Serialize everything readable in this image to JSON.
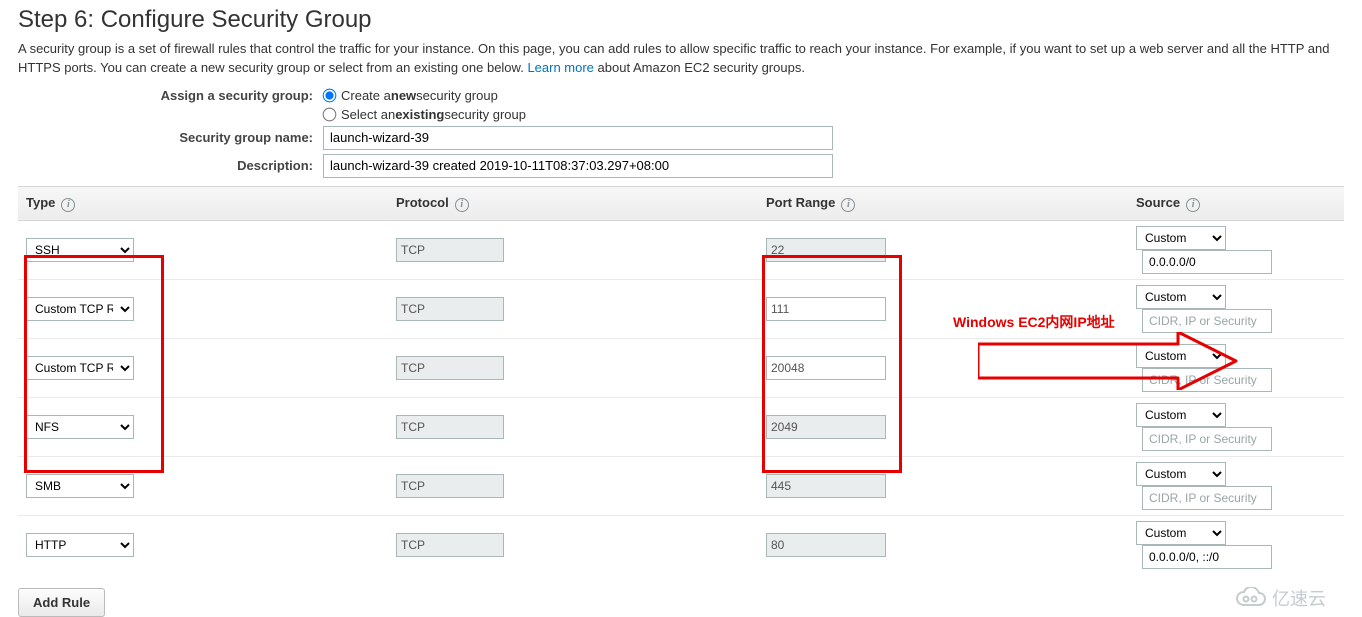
{
  "header": {
    "title": "Step 6: Configure Security Group",
    "description_pre": "A security group is a set of firewall rules that control the traffic for your instance. On this page, you can add rules to allow specific traffic to reach your instance. For example, if you want to set up a web server and all the HTTP and HTTPS ports. You can create a new security group or select from an existing one below. ",
    "learn_more_label": "Learn more",
    "description_post": " about Amazon EC2 security groups."
  },
  "form": {
    "assign_label": "Assign a security group:",
    "create_option_pre": "Create a ",
    "create_option_bold": "new",
    "create_option_post": " security group",
    "select_option_pre": "Select an ",
    "select_option_bold": "existing",
    "select_option_post": " security group",
    "name_label": "Security group name:",
    "name_value": "launch-wizard-39",
    "description_label": "Description:",
    "description_value": "launch-wizard-39 created 2019-10-11T08:37:03.297+08:00"
  },
  "columns": {
    "type": "Type",
    "protocol": "Protocol",
    "port_range": "Port Range",
    "source": "Source"
  },
  "cidr_placeholder": "CIDR, IP or Security",
  "rules": [
    {
      "type": "SSH",
      "protocol": "TCP",
      "port": "22",
      "port_editable": false,
      "source_type": "Custom",
      "cidr": "0.0.0.0/0"
    },
    {
      "type": "Custom TCP Rule",
      "protocol": "TCP",
      "port": "111",
      "port_editable": true,
      "source_type": "Custom",
      "cidr": ""
    },
    {
      "type": "Custom TCP Rule",
      "protocol": "TCP",
      "port": "20048",
      "port_editable": true,
      "source_type": "Custom",
      "cidr": ""
    },
    {
      "type": "NFS",
      "protocol": "TCP",
      "port": "2049",
      "port_editable": false,
      "source_type": "Custom",
      "cidr": ""
    },
    {
      "type": "SMB",
      "protocol": "TCP",
      "port": "445",
      "port_editable": false,
      "source_type": "Custom",
      "cidr": ""
    },
    {
      "type": "HTTP",
      "protocol": "TCP",
      "port": "80",
      "port_editable": false,
      "source_type": "Custom",
      "cidr": "0.0.0.0/0, ::/0"
    }
  ],
  "add_rule_label": "Add Rule",
  "annotation": {
    "text": "Windows EC2内网IP地址"
  },
  "watermark": "亿速云"
}
